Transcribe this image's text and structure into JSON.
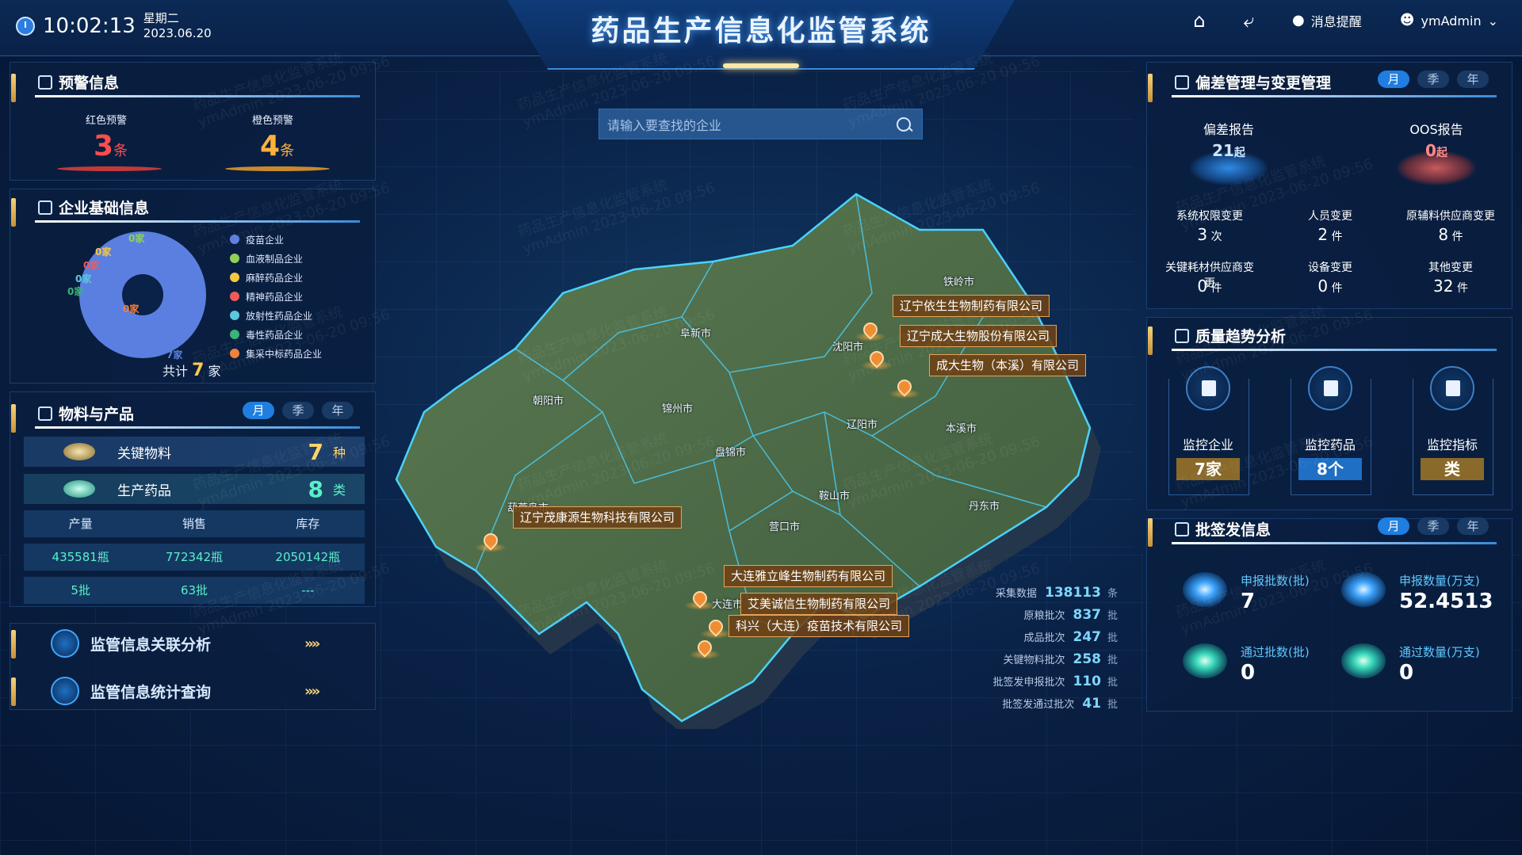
{
  "header": {
    "time": "10:02:13",
    "weekday": "星期二",
    "date": "2023.06.20",
    "title": "药品生产信息化监管系统",
    "notify_label": "消息提醒",
    "user": "ymAdmin",
    "icons": [
      "clock-icon",
      "home-icon",
      "back-icon",
      "bell-icon",
      "user-icon",
      "chevron-down-icon"
    ]
  },
  "watermark": {
    "line1": "药品生产信息化监管系统",
    "line2": "ymAdmin 2023-06-20 09:56"
  },
  "warning": {
    "title": "预警信息",
    "red_label": "红色预警",
    "red_count": "3",
    "red_unit": "条",
    "orange_label": "橙色预警",
    "orange_count": "4",
    "orange_unit": "条"
  },
  "enterprise": {
    "title": "企业基础信息",
    "total_prefix": "共计",
    "total_value": "7",
    "total_unit": "家",
    "callouts": [
      "0家",
      "0家",
      "0家",
      "0家",
      "0家",
      "0家",
      "7家"
    ],
    "legend": [
      {
        "label": "疫苗企业",
        "color": "#5b7fe0"
      },
      {
        "label": "血液制品企业",
        "color": "#8fd15a"
      },
      {
        "label": "麻醉药品企业",
        "color": "#f5c842"
      },
      {
        "label": "精神药品企业",
        "color": "#ef5a5a"
      },
      {
        "label": "放射性药品企业",
        "color": "#5ac8e0"
      },
      {
        "label": "毒性药品企业",
        "color": "#3bb37a"
      },
      {
        "label": "集采中标药品企业",
        "color": "#f0803c"
      }
    ]
  },
  "chart_data": {
    "type": "pie",
    "categories": [
      "疫苗企业",
      "血液制品企业",
      "麻醉药品企业",
      "精神药品企业",
      "放射性药品企业",
      "毒性药品企业",
      "集采中标药品企业"
    ],
    "values": [
      7,
      0,
      0,
      0,
      0,
      0,
      0
    ],
    "unit": "家"
  },
  "materials": {
    "title": "物料与产品",
    "tabs": [
      "月",
      "季",
      "年"
    ],
    "key_material_label": "关键物料",
    "key_material_value": "7",
    "key_material_unit": "种",
    "product_label": "生产药品",
    "product_value": "8",
    "product_unit": "类",
    "columns": [
      "产量",
      "销售",
      "库存"
    ],
    "rows": [
      [
        "435581瓶",
        "772342瓶",
        "2050142瓶"
      ],
      [
        "5批",
        "63批",
        "---"
      ]
    ]
  },
  "links": {
    "analysis": "监管信息关联分析",
    "query": "监管信息统计查询",
    "arrow": "»»"
  },
  "map": {
    "search_placeholder": "请输入要查找的企业",
    "cities": [
      "铁岭市",
      "阜新市",
      "沈阳市",
      "朝阳市",
      "锦州市",
      "辽阳市",
      "本溪市",
      "盘锦市",
      "鞍山市",
      "葫芦岛市",
      "营口市",
      "丹东市",
      "大连市"
    ],
    "companies": [
      "辽宁依生生物制药有限公司",
      "辽宁成大生物股份有限公司",
      "成大生物（本溪）有限公司",
      "辽宁茂康源生物科技有限公司",
      "大连雅立峰生物制药有限公司",
      "艾美诚信生物制药有限公司",
      "科兴（大连）疫苗技术有限公司"
    ],
    "stats": [
      {
        "name": "采集数据",
        "value": "138113",
        "unit": "条"
      },
      {
        "name": "原粮批次",
        "value": "837",
        "unit": "批"
      },
      {
        "name": "成品批次",
        "value": "247",
        "unit": "批"
      },
      {
        "name": "关键物料批次",
        "value": "258",
        "unit": "批"
      },
      {
        "name": "批签发申报批次",
        "value": "110",
        "unit": "批"
      },
      {
        "name": "批签发通过批次",
        "value": "41",
        "unit": "批"
      }
    ]
  },
  "deviation": {
    "title": "偏差管理与变更管理",
    "tabs": [
      "月",
      "季",
      "年"
    ],
    "report_label": "偏差报告",
    "report_value": "21",
    "report_unit": "起",
    "oos_label": "OOS报告",
    "oos_value": "0",
    "oos_unit": "起",
    "items": [
      {
        "label": "系统权限变更",
        "value": "3",
        "unit": "次"
      },
      {
        "label": "人员变更",
        "value": "2",
        "unit": "件"
      },
      {
        "label": "原辅料供应商变更",
        "value": "8",
        "unit": "件"
      },
      {
        "label": "关键耗材供应商变更",
        "value": "0",
        "unit": "件"
      },
      {
        "label": "设备变更",
        "value": "0",
        "unit": "件"
      },
      {
        "label": "其他变更",
        "value": "32",
        "unit": "件"
      }
    ]
  },
  "quality": {
    "title": "质量趋势分析",
    "items": [
      {
        "label": "监控企业",
        "value": "7家",
        "color": "#8a6a2a"
      },
      {
        "label": "监控药品",
        "value": "8个",
        "color": "#1f6fc4"
      },
      {
        "label": "监控指标",
        "value": "类",
        "color": "#8a6a2a"
      }
    ]
  },
  "batch": {
    "title": "批签发信息",
    "tabs": [
      "月",
      "季",
      "年"
    ],
    "apply_batch_label": "申报批数(批)",
    "apply_batch_value": "7",
    "apply_qty_label": "申报数量(万支)",
    "apply_qty_value": "52.4513",
    "pass_batch_label": "通过批数(批)",
    "pass_batch_value": "0",
    "pass_qty_label": "通过数量(万支)",
    "pass_qty_value": "0"
  }
}
